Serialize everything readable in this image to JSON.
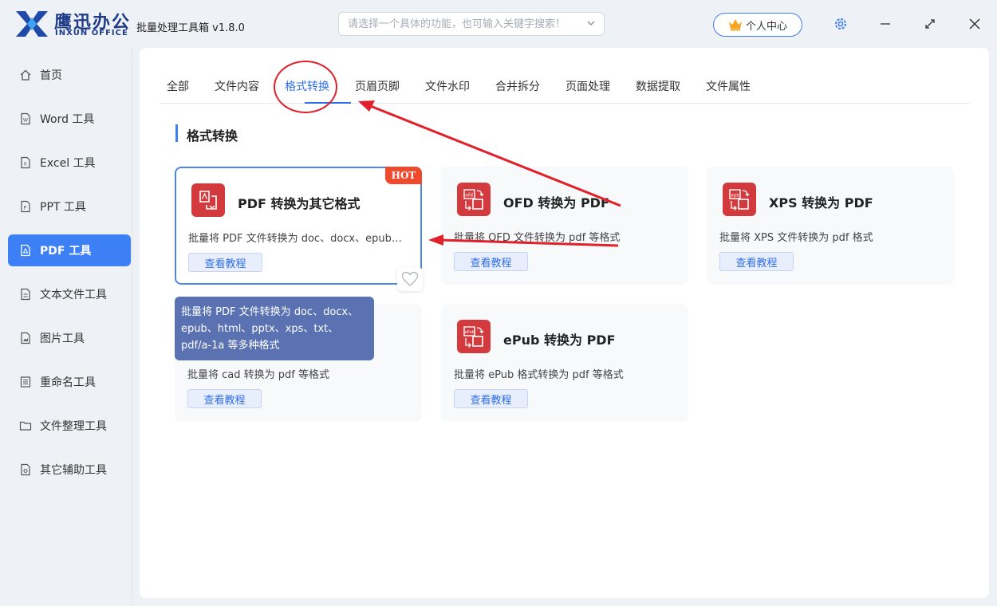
{
  "app": {
    "logo_cn": "鹰迅办公",
    "logo_en": "INXUN OFFICE",
    "title": "批量处理工具箱 v1.8.0"
  },
  "search": {
    "placeholder": "请选择一个具体的功能，也可输入关键字搜索！"
  },
  "header": {
    "user_center": "个人中心"
  },
  "sidebar": {
    "items": [
      {
        "label": "首页",
        "icon": "home-icon"
      },
      {
        "label": "Word 工具",
        "icon": "word-file-icon"
      },
      {
        "label": "Excel 工具",
        "icon": "excel-file-icon"
      },
      {
        "label": "PPT 工具",
        "icon": "ppt-file-icon"
      },
      {
        "label": "PDF 工具",
        "icon": "pdf-file-icon",
        "active": true
      },
      {
        "label": "文本文件工具",
        "icon": "text-file-icon"
      },
      {
        "label": "图片工具",
        "icon": "image-file-icon"
      },
      {
        "label": "重命名工具",
        "icon": "rename-icon"
      },
      {
        "label": "文件整理工具",
        "icon": "folder-icon"
      },
      {
        "label": "其它辅助工具",
        "icon": "tools-file-icon"
      }
    ]
  },
  "tabs": [
    {
      "label": "全部"
    },
    {
      "label": "文件内容"
    },
    {
      "label": "格式转换",
      "active": true
    },
    {
      "label": "页眉页脚"
    },
    {
      "label": "文件水印"
    },
    {
      "label": "合并拆分"
    },
    {
      "label": "页面处理"
    },
    {
      "label": "数据提取"
    },
    {
      "label": "文件属性"
    }
  ],
  "section": {
    "title": "格式转换"
  },
  "cards": [
    {
      "title": "PDF 转换为其它格式",
      "desc": "批量将 PDF 文件转换为 doc、docx、epub、html、pptx、xps、txt、pdf/a-1a 等多种格式",
      "button": "查看教程",
      "badge": "HOT",
      "icon_text": ""
    },
    {
      "title": "OFD 转换为 PDF",
      "desc": "批量将 OFD 文件转换为 pdf 等格式",
      "button": "查看教程",
      "icon_text": "ofd"
    },
    {
      "title": "XPS 转换为 PDF",
      "desc": "批量将 XPS 文件转换为 pdf 格式",
      "button": "查看教程",
      "icon_text": "xps"
    },
    {
      "title": "",
      "desc": "批量将 cad 转换为 pdf 等格式",
      "button": "查看教程",
      "icon_text": ""
    },
    {
      "title": "ePub 转换为 PDF",
      "desc": "批量将 ePub 格式转换为 pdf 等格式",
      "button": "查看教程",
      "icon_text": "ePub"
    }
  ],
  "tooltip": {
    "text": "批量将 PDF 文件转换为 doc、docx、epub、html、pptx、xps、txt、pdf/a-1a 等多种格式"
  },
  "colors": {
    "accent": "#3d7ff5",
    "card_icon": "#d33a3d",
    "hot_badge": "#f04a2e",
    "annotation": "#e0202a",
    "tooltip": "#5a71b2"
  }
}
